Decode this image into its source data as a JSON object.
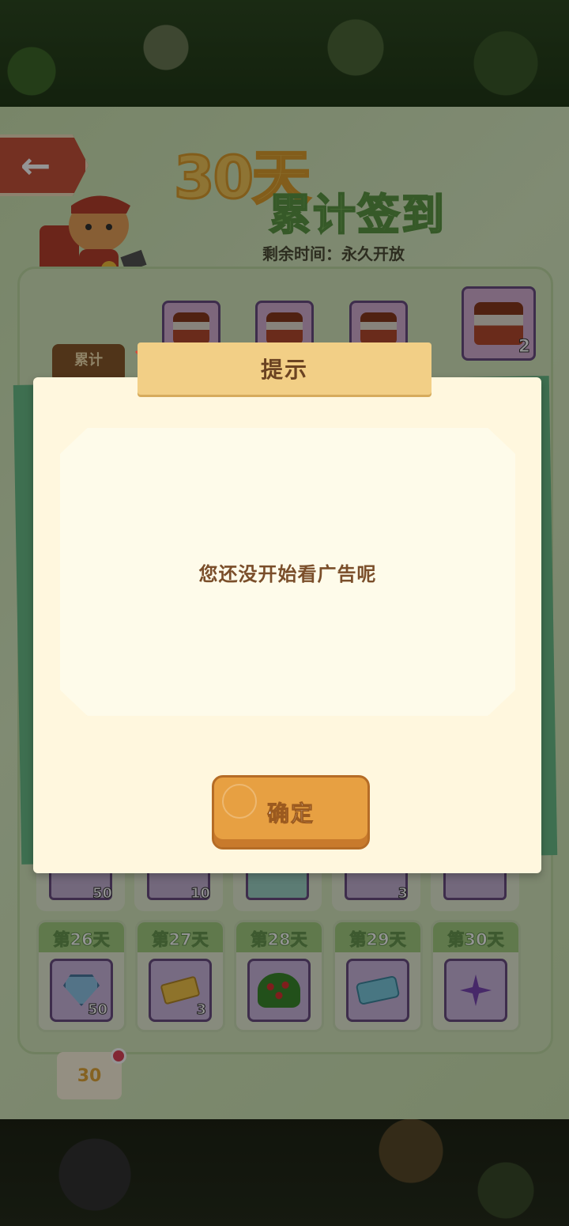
{
  "header": {
    "title_number": "30天",
    "title_text": "累计签到",
    "remaining": "剩余时间：永久开放"
  },
  "rewards_top": [
    {
      "icon": "cake-icon"
    },
    {
      "icon": "cake-icon"
    },
    {
      "icon": "cake-icon"
    },
    {
      "icon": "cake-stack-icon",
      "count": "2"
    }
  ],
  "leiji_label": "累计",
  "partial_row": [
    {
      "qty": "50"
    },
    {
      "qty": "10"
    },
    {
      "qty": ""
    },
    {
      "qty": "3"
    },
    {
      "qty": ""
    }
  ],
  "days": [
    {
      "label": "第26天",
      "icon": "gem-icon",
      "qty": "50"
    },
    {
      "label": "第27天",
      "icon": "ticket-icon",
      "qty": "3"
    },
    {
      "label": "第28天",
      "icon": "bush-icon",
      "qty": ""
    },
    {
      "label": "第29天",
      "icon": "blue-ticket-icon",
      "qty": ""
    },
    {
      "label": "第30天",
      "icon": "pinwheel-icon",
      "qty": ""
    }
  ],
  "calendar_badge": "30",
  "dialog": {
    "title": "提示",
    "message": "您还没开始看广告呢",
    "confirm_label": "确定"
  },
  "colors": {
    "accent_orange": "#e7a042",
    "ribbon": "#f2cf86",
    "text_brown": "#7a4e2a",
    "panel_green": "#cfe6b4"
  }
}
